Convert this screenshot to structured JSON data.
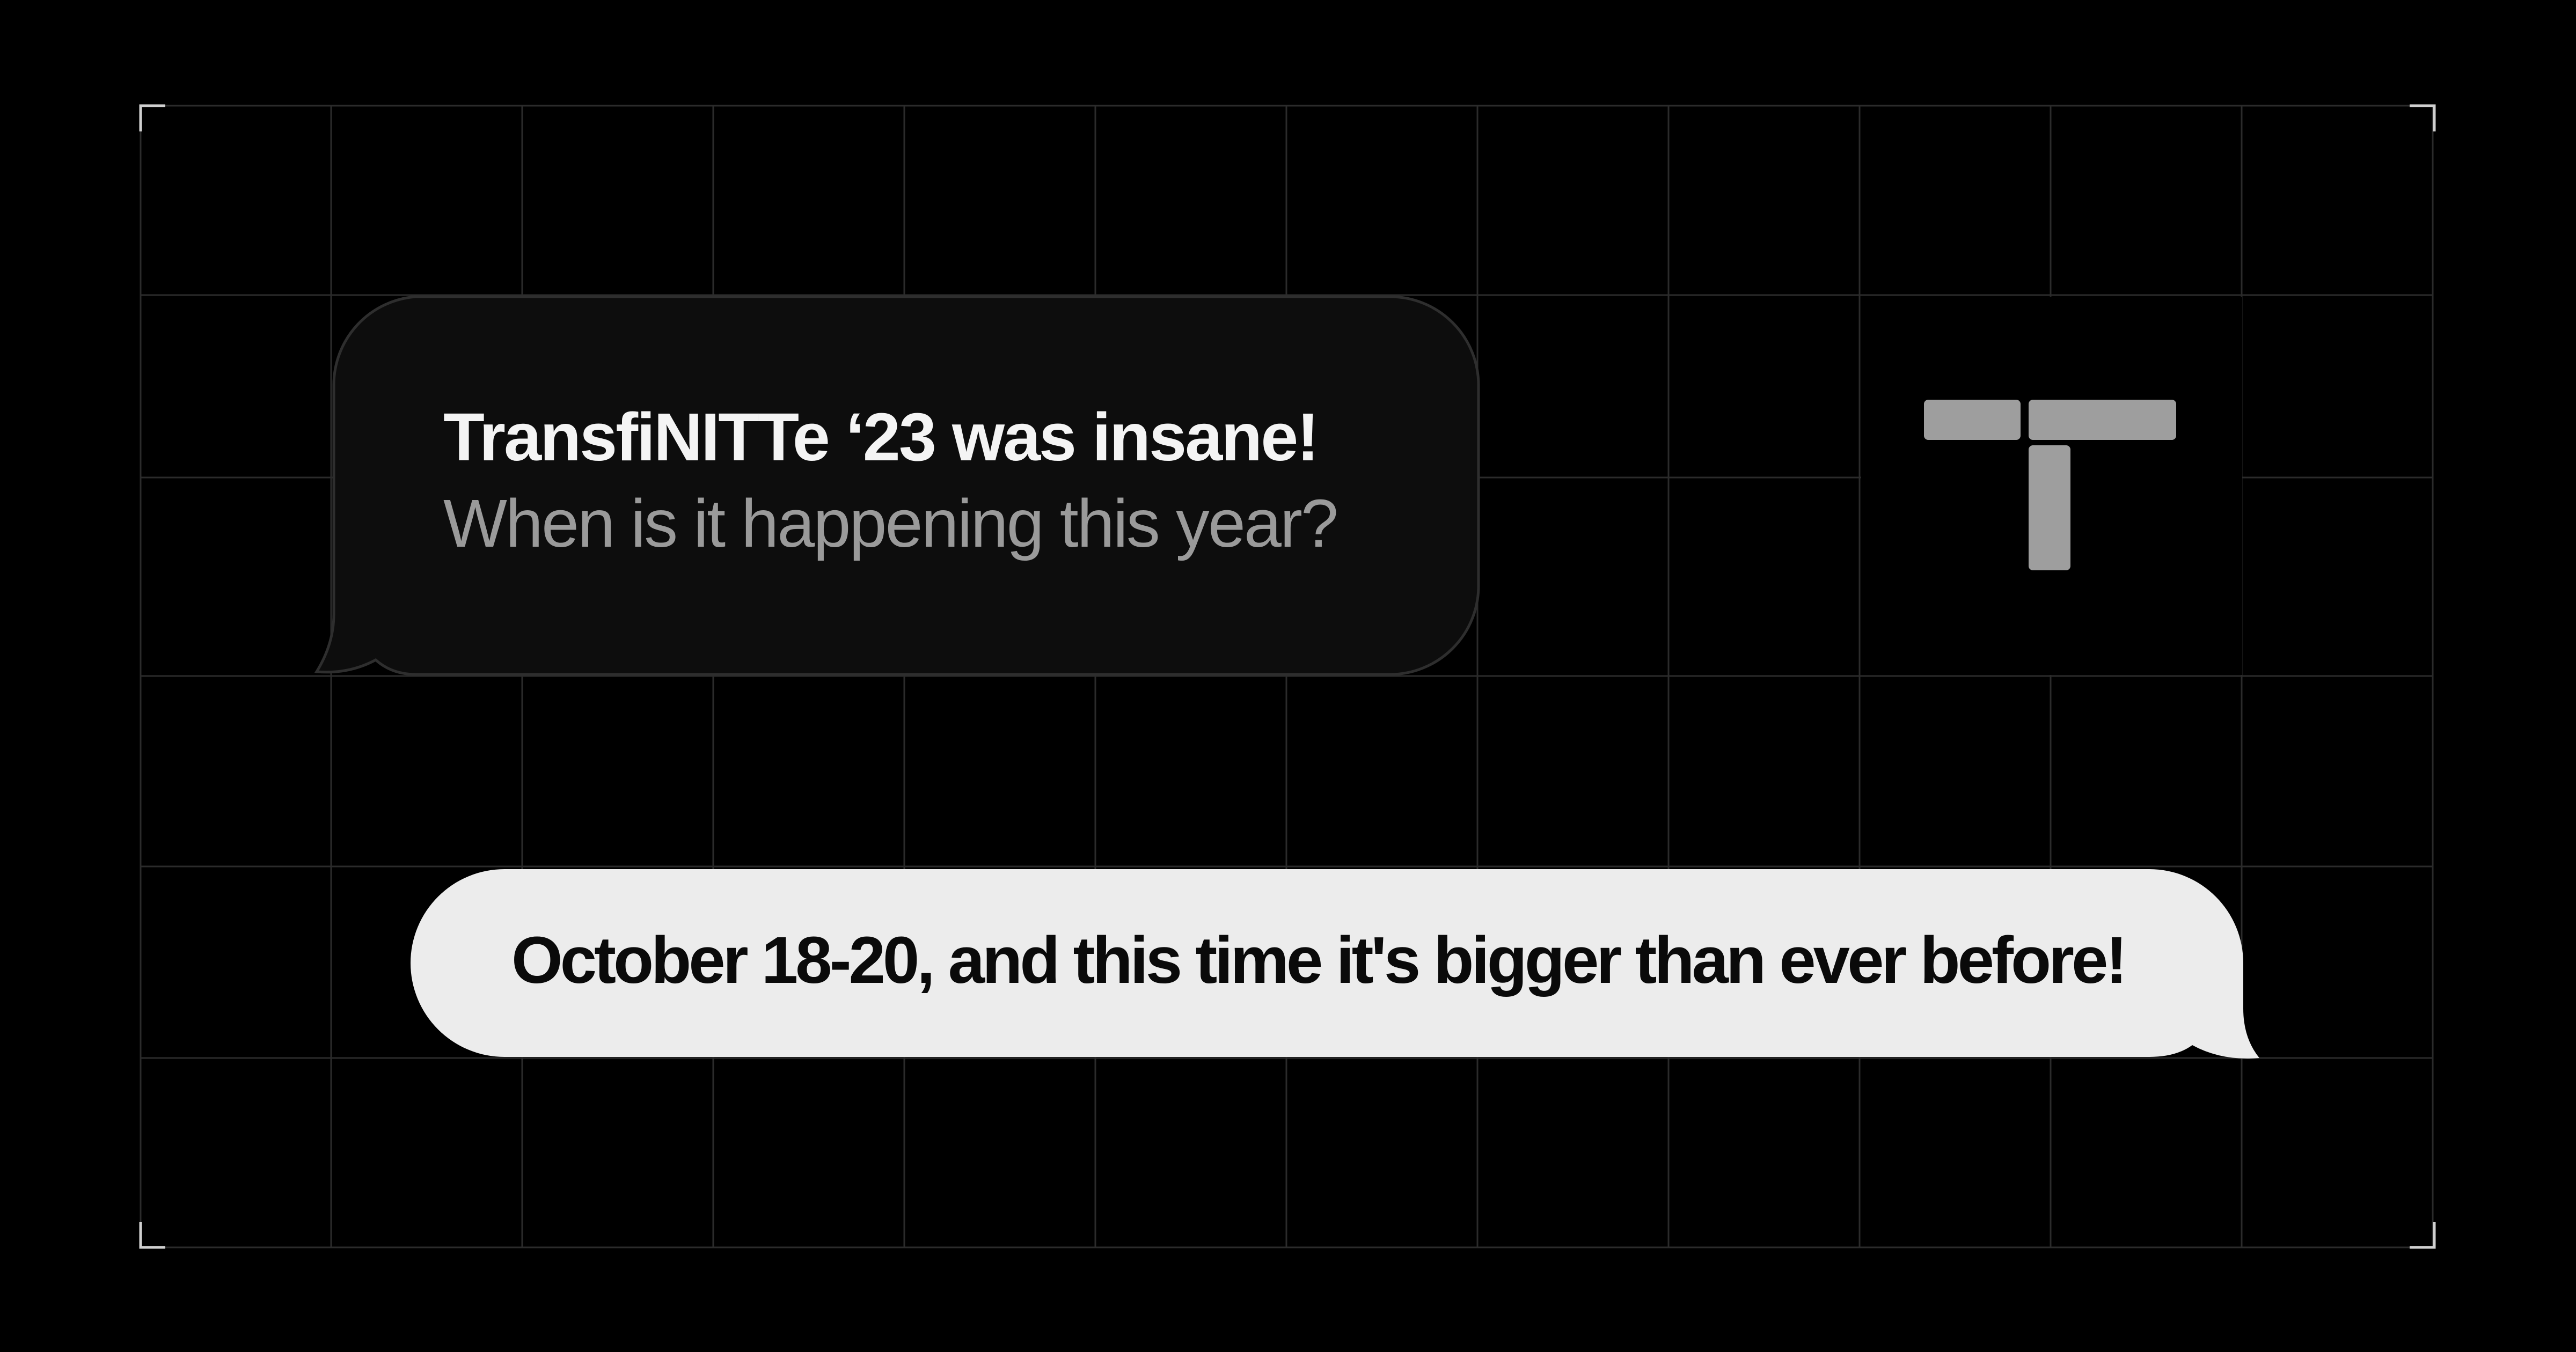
{
  "conversation": {
    "incoming_message": {
      "line_1": "TransfiNITTe ‘23 was insane!",
      "line_2": "When is it happening this year?"
    },
    "outgoing_message": {
      "text": "October 18-20, and this time it's bigger than ever before!"
    }
  },
  "colors": {
    "background": "#000000",
    "grid_line": "#2b2b2b",
    "incoming_bubble_fill": "#0d0d0d",
    "incoming_bubble_border": "#2e2e2e",
    "incoming_primary_text": "#f4f4f4",
    "incoming_secondary_text": "#9a9a9a",
    "outgoing_bubble_fill": "#ececec",
    "outgoing_text": "#0a0a0a",
    "logo": "#9e9e9e",
    "frame_corner": "#d0d0d0"
  },
  "logo": {
    "icon": "t-monogram-logo"
  }
}
